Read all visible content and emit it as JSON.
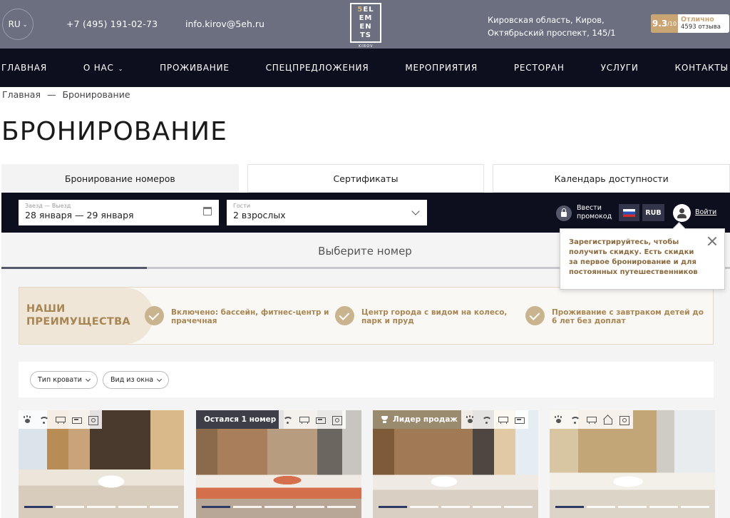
{
  "header": {
    "lang": "RU",
    "phone": "+7 (495) 191-02-73",
    "email": "info.kirov@5eh.ru",
    "logo": {
      "line1_accent": "5",
      "line1": "EL",
      "line2": "EM",
      "line3": "EN",
      "line4": "TS",
      "sub": "KIROV"
    },
    "address_line1": "Кировская область, Киров,",
    "address_line2": "Октябрьский проспект, 145/1",
    "rating": {
      "score": "9.3",
      "scale": "/10",
      "label": "Отлично",
      "reviews": "4593 отзыва"
    }
  },
  "nav": [
    {
      "label": "Главная"
    },
    {
      "label": "О нас",
      "has_dropdown": true
    },
    {
      "label": "Проживание"
    },
    {
      "label": "Спецпредложения"
    },
    {
      "label": "Мероприятия"
    },
    {
      "label": "Ресторан"
    },
    {
      "label": "Услуги"
    },
    {
      "label": "Контакты"
    }
  ],
  "breadcrumb": {
    "home": "Главная",
    "separator": "—",
    "current": "Бронирование"
  },
  "page_title": "БРОНИРОВАНИЕ",
  "tabs": [
    {
      "label": "Бронирование номеров",
      "active": true
    },
    {
      "label": "Сертификаты",
      "active": false
    },
    {
      "label": "Календарь доступности",
      "active": false
    }
  ],
  "booking": {
    "dates_label": "Заезд — Выезд",
    "dates_value": "28 января — 29 января",
    "guests_label": "Гости",
    "guests_value": "2 взрослых",
    "promo_line1": "Ввести",
    "promo_line2": "промокод",
    "currency": "RUB",
    "login": "Войти"
  },
  "tooltip": {
    "message": "Зарегистрируйтесь, чтобы получить скидку. Есть скидки за первое бронирование и для постоянных путешественников"
  },
  "step": {
    "title": "Выберите номер",
    "progress_fraction": 0.2
  },
  "advantages": {
    "heading_line1": "НАШИ",
    "heading_line2": "ПРЕИМУЩЕСТВА",
    "items": [
      {
        "text": "Включено: бассейн, фитнес-центр и прачечная"
      },
      {
        "text": "Центр города с видом на колесо, парк и пруд"
      },
      {
        "text": "Проживание с завтраком детей до 6 лет без доплат"
      }
    ]
  },
  "filters": [
    {
      "label": "Тип кровати"
    },
    {
      "label": "Вид из окна"
    }
  ],
  "rooms": [
    {
      "badge": "",
      "amenities": [
        "paw-icon",
        "wifi-icon",
        "ac-icon",
        "bed-icon",
        "safe-icon"
      ]
    },
    {
      "badge": "Остался 1 номер",
      "amenities": [
        "wifi-icon",
        "ac-icon",
        "bed-icon",
        "safe-icon"
      ]
    },
    {
      "badge": "Лидер продаж",
      "badge_icon": "trophy-icon",
      "amenities": [
        "paw-icon",
        "wifi-icon",
        "ac-icon",
        "bed-icon"
      ]
    },
    {
      "badge": "",
      "amenities": [
        "paw-icon",
        "wifi-icon",
        "ac-icon",
        "house-icon",
        "safe-icon"
      ]
    }
  ],
  "colors": {
    "nav_bg": "#0e0f1e",
    "top_bg": "#6b6f80",
    "accent_gold": "#c9a574",
    "advantage_text": "#a88654"
  }
}
